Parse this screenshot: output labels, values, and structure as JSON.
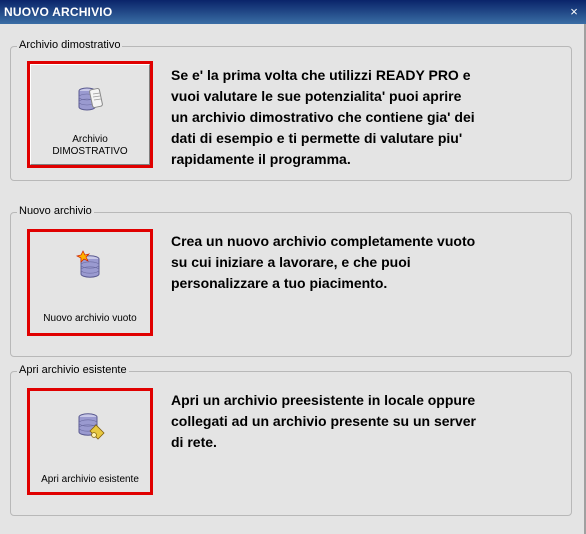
{
  "window": {
    "title": "NUOVO ARCHIVIO",
    "close_glyph": "×"
  },
  "groups": [
    {
      "label": "Archivio dimostrativo",
      "button_label_line1": "Archivio",
      "button_label_line2": "DIMOSTRATIVO",
      "icon": "database-scroll-icon",
      "description_lines": [
        "Se e' la prima volta che utilizzi READY PRO e",
        "vuoi valutare le sue potenzialita' puoi aprire",
        "un archivio dimostrativo che contiene gia' dei",
        "dati di esempio e ti permette di valutare piu'",
        "rapidamente il programma."
      ]
    },
    {
      "label": "Nuovo archivio",
      "button_label": "Nuovo archivio vuoto",
      "icon": "database-new-icon",
      "description_lines": [
        "Crea un nuovo archivio completamente vuoto",
        "su cui iniziare a lavorare, e che puoi",
        "personalizzare a tuo piacimento."
      ]
    },
    {
      "label": "Apri archivio esistente",
      "button_label": "Apri archivio esistente",
      "icon": "database-open-icon",
      "description_lines": [
        "Apri un archivio preesistente in locale oppure",
        "collegati ad un archivio presente su un server",
        "di rete."
      ]
    }
  ],
  "colors": {
    "highlight_border": "#e00000",
    "titlebar": "#0a246a"
  }
}
